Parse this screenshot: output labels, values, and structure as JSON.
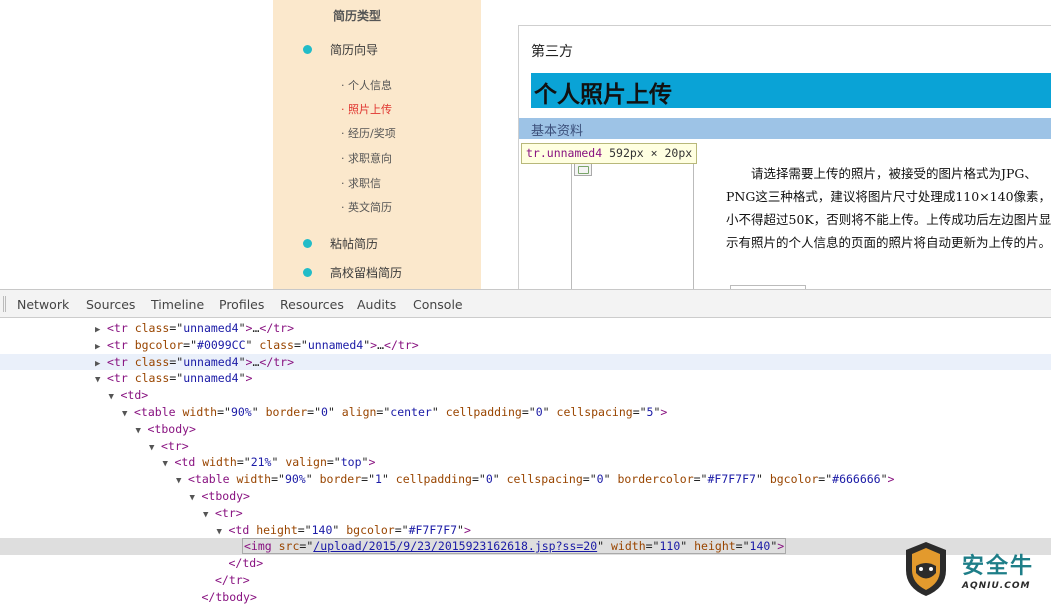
{
  "sidebar": {
    "heading": "简历类型",
    "items": [
      {
        "label": "简历向导"
      },
      {
        "label": "粘帖简历"
      },
      {
        "label": "高校留档简历"
      }
    ],
    "sub_items": [
      {
        "label": "· 个人信息"
      },
      {
        "label": "· 照片上传"
      },
      {
        "label": "· 经历/奖项"
      },
      {
        "label": "· 求职意向"
      },
      {
        "label": "· 求职信"
      },
      {
        "label": "· 英文简历"
      }
    ]
  },
  "content": {
    "breadcrumb": "第三方",
    "page_title": "个人照片上传",
    "section_title": "基本资料",
    "instructions": "请选择需要上传的照片，被接受的图片格式为JPG、PNG这三种格式，建议将图片尺寸处理成110×140像素，小不得超过50K，否则将不能上传。上传成功后左边图片显示有照片的个人信息的页面的照片将自动更新为上传的片。"
  },
  "tooltip": {
    "selector": "tr.unnamed4",
    "dims": "592px × 20px"
  },
  "devtools": {
    "tabs": [
      "Network",
      "Sources",
      "Timeline",
      "Profiles",
      "Resources",
      "Audits",
      "Console"
    ],
    "lines": [
      {
        "indent": 8,
        "tri": "▶",
        "parts": [
          [
            "t",
            "<tr "
          ],
          [
            "a",
            "class"
          ],
          [
            "p",
            "=\""
          ],
          [
            "v",
            "unnamed4"
          ],
          [
            "p",
            "\""
          ],
          [
            "t",
            ">"
          ],
          [
            "p",
            "…"
          ],
          [
            "t",
            "</tr>"
          ]
        ]
      },
      {
        "indent": 8,
        "tri": "▶",
        "parts": [
          [
            "t",
            "<tr "
          ],
          [
            "a",
            "bgcolor"
          ],
          [
            "p",
            "=\""
          ],
          [
            "v",
            "#0099CC"
          ],
          [
            "p",
            "\" "
          ],
          [
            "a",
            "class"
          ],
          [
            "p",
            "=\""
          ],
          [
            "v",
            "unnamed4"
          ],
          [
            "p",
            "\""
          ],
          [
            "t",
            ">"
          ],
          [
            "p",
            "…"
          ],
          [
            "t",
            "</tr>"
          ]
        ]
      },
      {
        "indent": 8,
        "tri": "▶",
        "state": "hover",
        "parts": [
          [
            "t",
            "<tr "
          ],
          [
            "a",
            "class"
          ],
          [
            "p",
            "=\""
          ],
          [
            "v",
            "unnamed4"
          ],
          [
            "p",
            "\""
          ],
          [
            "t",
            ">"
          ],
          [
            "p",
            "…"
          ],
          [
            "t",
            "</tr>"
          ]
        ]
      },
      {
        "indent": 8,
        "tri": "▼",
        "parts": [
          [
            "t",
            "<tr "
          ],
          [
            "a",
            "class"
          ],
          [
            "p",
            "=\""
          ],
          [
            "v",
            "unnamed4"
          ],
          [
            "p",
            "\""
          ],
          [
            "t",
            ">"
          ]
        ]
      },
      {
        "indent": 9,
        "tri": "▼",
        "parts": [
          [
            "t",
            "<td>"
          ]
        ]
      },
      {
        "indent": 10,
        "tri": "▼",
        "parts": [
          [
            "t",
            "<table "
          ],
          [
            "a",
            "width"
          ],
          [
            "p",
            "=\""
          ],
          [
            "v",
            "90%"
          ],
          [
            "p",
            "\" "
          ],
          [
            "a",
            "border"
          ],
          [
            "p",
            "=\""
          ],
          [
            "v",
            "0"
          ],
          [
            "p",
            "\" "
          ],
          [
            "a",
            "align"
          ],
          [
            "p",
            "=\""
          ],
          [
            "v",
            "center"
          ],
          [
            "p",
            "\" "
          ],
          [
            "a",
            "cellpadding"
          ],
          [
            "p",
            "=\""
          ],
          [
            "v",
            "0"
          ],
          [
            "p",
            "\" "
          ],
          [
            "a",
            "cellspacing"
          ],
          [
            "p",
            "=\""
          ],
          [
            "v",
            "5"
          ],
          [
            "p",
            "\""
          ],
          [
            "t",
            ">"
          ]
        ]
      },
      {
        "indent": 11,
        "tri": "▼",
        "parts": [
          [
            "t",
            "<tbody>"
          ]
        ]
      },
      {
        "indent": 12,
        "tri": "▼",
        "parts": [
          [
            "t",
            "<tr>"
          ]
        ]
      },
      {
        "indent": 13,
        "tri": "▼",
        "parts": [
          [
            "t",
            "<td "
          ],
          [
            "a",
            "width"
          ],
          [
            "p",
            "=\""
          ],
          [
            "v",
            "21%"
          ],
          [
            "p",
            "\" "
          ],
          [
            "a",
            "valign"
          ],
          [
            "p",
            "=\""
          ],
          [
            "v",
            "top"
          ],
          [
            "p",
            "\""
          ],
          [
            "t",
            ">"
          ]
        ]
      },
      {
        "indent": 14,
        "tri": "▼",
        "parts": [
          [
            "t",
            "<table "
          ],
          [
            "a",
            "width"
          ],
          [
            "p",
            "=\""
          ],
          [
            "v",
            "90%"
          ],
          [
            "p",
            "\" "
          ],
          [
            "a",
            "border"
          ],
          [
            "p",
            "=\""
          ],
          [
            "v",
            "1"
          ],
          [
            "p",
            "\" "
          ],
          [
            "a",
            "cellpadding"
          ],
          [
            "p",
            "=\""
          ],
          [
            "v",
            "0"
          ],
          [
            "p",
            "\" "
          ],
          [
            "a",
            "cellspacing"
          ],
          [
            "p",
            "=\""
          ],
          [
            "v",
            "0"
          ],
          [
            "p",
            "\" "
          ],
          [
            "a",
            "bordercolor"
          ],
          [
            "p",
            "=\""
          ],
          [
            "v",
            "#F7F7F7"
          ],
          [
            "p",
            "\" "
          ],
          [
            "a",
            "bgcolor"
          ],
          [
            "p",
            "=\""
          ],
          [
            "v",
            "#666666"
          ],
          [
            "p",
            "\""
          ],
          [
            "t",
            ">"
          ]
        ]
      },
      {
        "indent": 15,
        "tri": "▼",
        "parts": [
          [
            "t",
            "<tbody>"
          ]
        ]
      },
      {
        "indent": 16,
        "tri": "▼",
        "parts": [
          [
            "t",
            "<tr>"
          ]
        ]
      },
      {
        "indent": 17,
        "tri": "▼",
        "parts": [
          [
            "t",
            "<td "
          ],
          [
            "a",
            "height"
          ],
          [
            "p",
            "=\""
          ],
          [
            "v",
            "140"
          ],
          [
            "p",
            "\" "
          ],
          [
            "a",
            "bgcolor"
          ],
          [
            "p",
            "=\""
          ],
          [
            "v",
            "#F7F7F7"
          ],
          [
            "p",
            "\""
          ],
          [
            "t",
            ">"
          ]
        ]
      },
      {
        "indent": 18,
        "tri": "",
        "state": "selected",
        "boxed": true,
        "parts": [
          [
            "t",
            "<img "
          ],
          [
            "a",
            "src"
          ],
          [
            "p",
            "=\""
          ],
          [
            "link",
            "/upload/2015/9/23/2015923162618.jsp?ss=20"
          ],
          [
            "p",
            "\" "
          ],
          [
            "a",
            "width"
          ],
          [
            "p",
            "=\""
          ],
          [
            "v",
            "110"
          ],
          [
            "p",
            "\" "
          ],
          [
            "a",
            "height"
          ],
          [
            "p",
            "=\""
          ],
          [
            "v",
            "140"
          ],
          [
            "p",
            "\""
          ],
          [
            "t",
            ">"
          ]
        ]
      },
      {
        "indent": 17,
        "tri": "",
        "parts": [
          [
            "t",
            "</td>"
          ]
        ]
      },
      {
        "indent": 16,
        "tri": "",
        "parts": [
          [
            "t",
            "</tr>"
          ]
        ]
      },
      {
        "indent": 15,
        "tri": "",
        "parts": [
          [
            "t",
            "</tbody>"
          ]
        ]
      }
    ]
  },
  "watermark": {
    "brand": "安全牛",
    "domain": "AQNIU.COM"
  },
  "colors": {
    "sidebar_bg": "#fbe8cc",
    "sidebar_dot": "#22bcc8",
    "title_bar": "#0aa3d6",
    "section_bar": "#9dc3e6",
    "tag": "#881280",
    "attr": "#994500",
    "value": "#1a1aa6"
  }
}
